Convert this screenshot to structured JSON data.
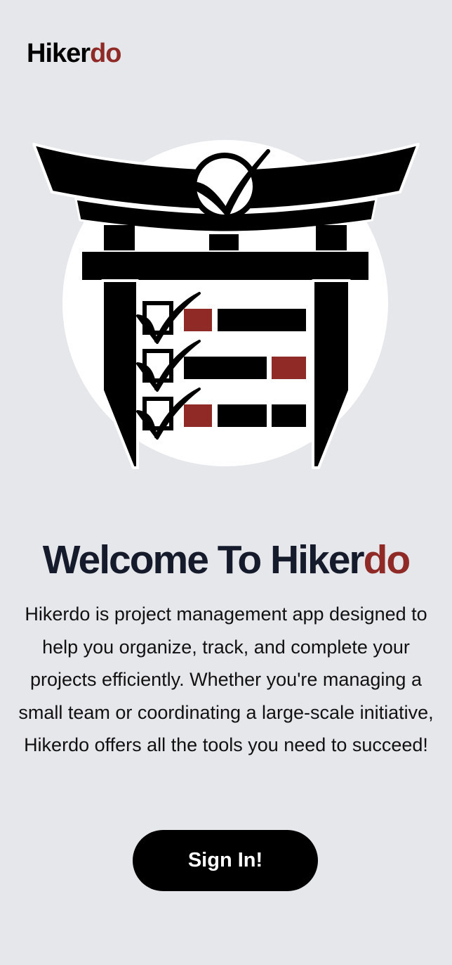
{
  "header": {
    "logo_part1": "Hiker",
    "logo_part2": "do"
  },
  "hero": {
    "title_part1": "Welcome To Hiker",
    "title_part2": "do",
    "description": "Hikerdo is project management app designed to help you organize, track, and complete your projects efficiently. Whether you're managing a small team or coordinating a large-scale initiative, Hikerdo offers all the tools you need to succeed!",
    "signin_label": "Sign In!"
  },
  "colors": {
    "background": "#e5e7eb",
    "brand_accent": "#8f2a26",
    "title_text": "#161b2c",
    "button_bg": "#000000",
    "button_text": "#ffffff"
  },
  "icons": {
    "hero_illustration": "torii-gate-checklist-illustration"
  }
}
